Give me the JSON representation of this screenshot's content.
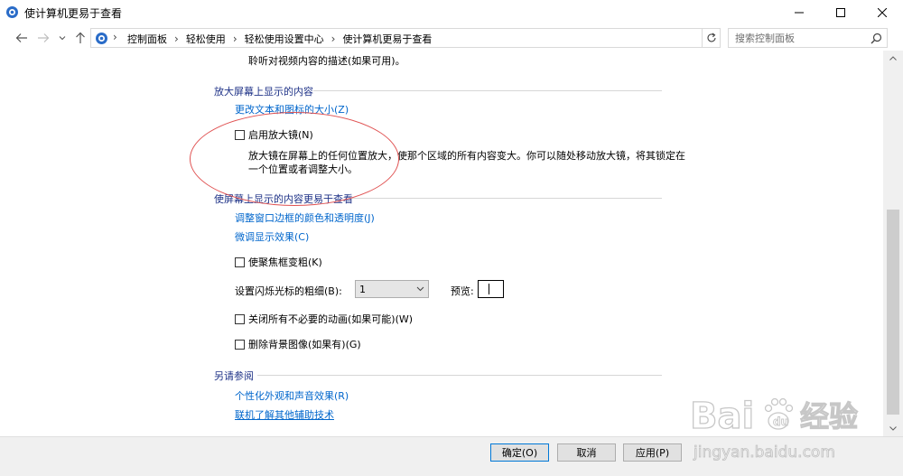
{
  "window": {
    "title": "使计算机更易于查看",
    "icon": "control-panel-icon",
    "controls": {
      "minimize": "minimize-icon",
      "maximize": "maximize-icon",
      "close": "close-icon"
    }
  },
  "address": {
    "breadcrumbs": [
      "控制面板",
      "轻松使用",
      "轻松使用设置中心",
      "使计算机更易于查看"
    ],
    "search_placeholder": "搜索控制面板"
  },
  "content": {
    "top_text": "聆听对视频内容的描述(如果可用)。",
    "magnify": {
      "title": "放大屏幕上显示的内容",
      "link_text_size": "更改文本和图标的大小(Z)",
      "checkbox_magnifier": "启用放大镜(N)",
      "magnifier_desc_1": "放大镜在屏幕上的任何位置放大，使那个区域的所有内容变大。你可以随处移动放大镜，将其锁定在",
      "magnifier_desc_2": "一个位置或者调整大小。"
    },
    "easier": {
      "title": "使屏幕上显示的内容更易于查看",
      "link_window_colors": "调整窗口边框的颜色和透明度(J)",
      "link_tune_display": "微调显示效果(C)",
      "checkbox_focus": "使聚焦框变粗(K)",
      "cursor_label": "设置闪烁光标的粗细(B):",
      "cursor_value": "1",
      "preview_label": "预览:",
      "checkbox_animations": "关闭所有不必要的动画(如果可能)(W)",
      "checkbox_background": "删除背景图像(如果有)(G)"
    },
    "see_also": {
      "title": "另请参阅",
      "link_personalize": "个性化外观和声音效果(R)",
      "link_assistive": "联机了解其他辅助技术"
    }
  },
  "buttons": {
    "ok": "确定(O)",
    "cancel": "取消",
    "apply": "应用(P)"
  },
  "watermark": {
    "brand": "Bai",
    "brand_suffix": "经验",
    "url": "jingyan.baidu.com"
  },
  "colors": {
    "link": "#0066cc",
    "section_title": "#1e3287",
    "annotation": "#e05252",
    "ok_border": "#0078d7"
  }
}
